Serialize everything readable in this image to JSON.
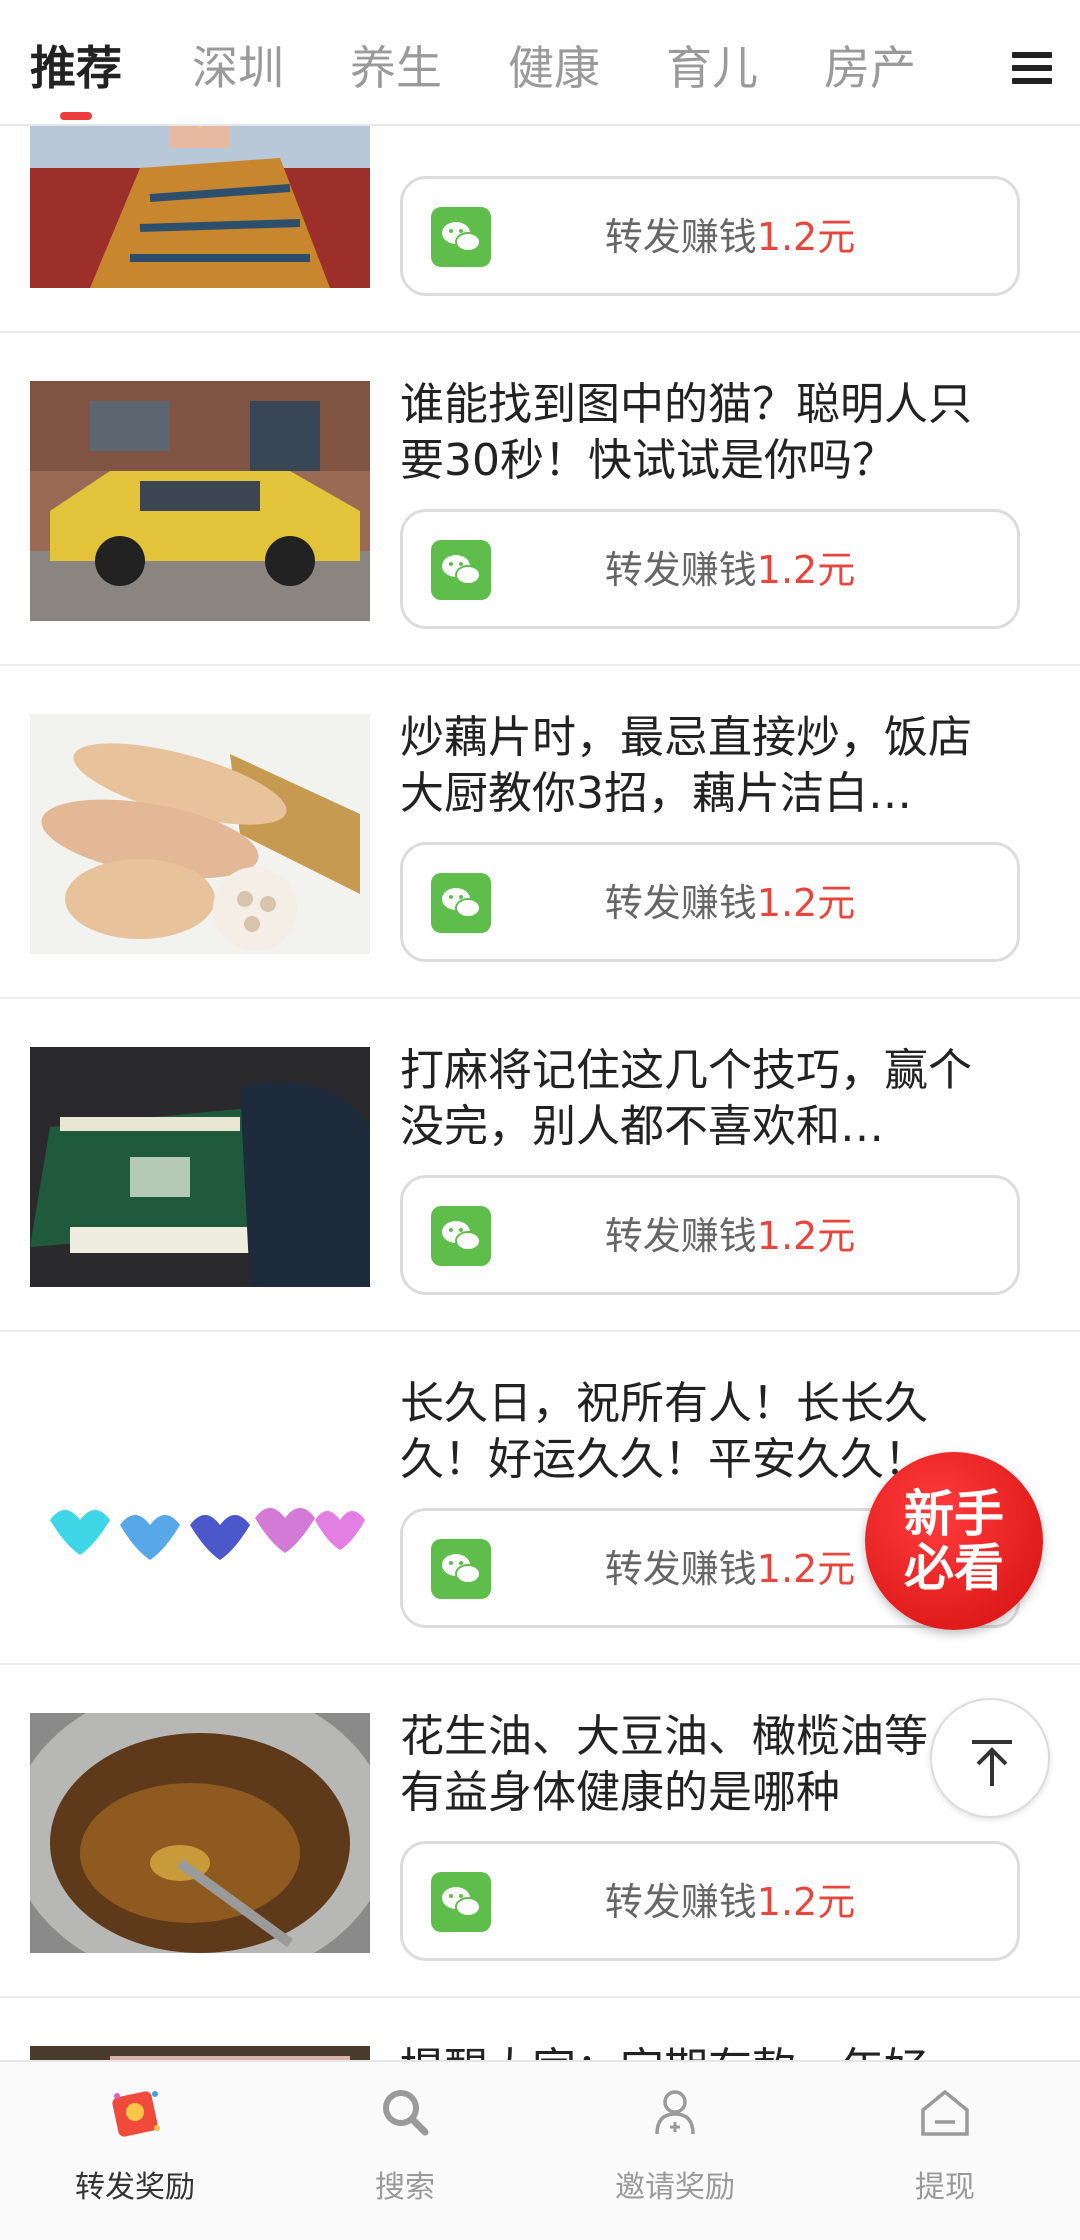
{
  "top_tabs": [
    {
      "label": "推荐",
      "active": true
    },
    {
      "label": "深圳",
      "active": false
    },
    {
      "label": "养生",
      "active": false
    },
    {
      "label": "健康",
      "active": false
    },
    {
      "label": "育儿",
      "active": false
    },
    {
      "label": "房产",
      "active": false
    }
  ],
  "share": {
    "prefix": "转发赚钱",
    "amount": "1.2元"
  },
  "articles": [
    {
      "title": "",
      "thumb_icon": "dancer-photo"
    },
    {
      "title": "谁能找到图中的猫？聪明人只要30秒！快试试是你吗？",
      "thumb_icon": "yellow-taxi-photo"
    },
    {
      "title": "炒藕片时，最忌直接炒，饭店大厨教你3招，藕片洁白…",
      "thumb_icon": "lotus-root-photo"
    },
    {
      "title": "打麻将记住这几个技巧，赢个没完，别人都不喜欢和…",
      "thumb_icon": "mahjong-photo"
    },
    {
      "title": "长久日，祝所有人！长长久久！好运久久！平安久久！",
      "thumb_icon": "hearts-graphic"
    },
    {
      "title": "花生油、大豆油、橄榄油等，有益身体健康的是哪种",
      "thumb_icon": "oil-pot-photo"
    },
    {
      "title": "提醒大家：定期存款一年好",
      "thumb_icon": "money-photo"
    }
  ],
  "float_newbie": {
    "line1": "新手",
    "line2": "必看"
  },
  "bottom_nav": [
    {
      "label": "转发奖励",
      "icon": "red-envelope-icon",
      "active": true
    },
    {
      "label": "搜索",
      "icon": "search-icon",
      "active": false
    },
    {
      "label": "邀请奖励",
      "icon": "invite-user-icon",
      "active": false
    },
    {
      "label": "提现",
      "icon": "withdraw-icon",
      "active": false
    }
  ],
  "colors": {
    "accent": "#ee3d3d",
    "amount": "#e8453c",
    "wechat": "#5fbd4b"
  }
}
